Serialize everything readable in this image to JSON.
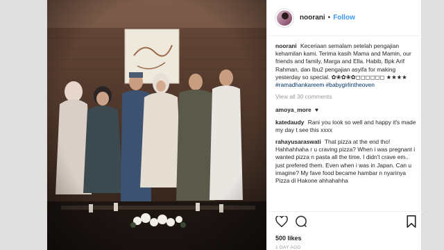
{
  "post": {
    "username": "noorani",
    "separator": "•",
    "follow_label": "Follow"
  },
  "caption": {
    "username": "noorani",
    "text": "Keceriaan semalam setelah pengajian kehamilan kami. Terima kasih Mama and Mamin, our friends and family, Marga and Ella. Habib, Bpk Arif Rahman, dan Ibu2 pengajian asyifa for making yesterday so special. ✿❀✿❀✿◻◻◻◻◻◻ ★★★★",
    "hashtag1": "#ramadhankareem",
    "hashtag2": "#babygirlintheoven"
  },
  "view_all_label": "View all 30 comments",
  "comments": [
    {
      "user": "amoya_more",
      "text": "♥"
    },
    {
      "user": "katedaudy",
      "text": "Rani you look so well and happy it's made my day t see this xxxx"
    },
    {
      "user": "rahayusaraswati",
      "text": "That pizza at the end tho! Hahhahhaha r u craving pizza? When i was pregnant i wanted pizza n pasta all the time. I didn't crave em.. just prefered them. Even when i was in Japan. Can u imagine? My fave food became hambar n nyarinya Pizza di Hakone ahhahahha"
    }
  ],
  "actions": {
    "likes_label": "500 likes",
    "time_label": "1 DAY AGO",
    "icons": [
      "heart-icon",
      "comment-icon",
      "bookmark-icon"
    ]
  },
  "colors": {
    "link_blue": "#3897f0",
    "hashtag_blue": "#003569",
    "muted_gray": "#999999",
    "text_dark": "#262626"
  }
}
